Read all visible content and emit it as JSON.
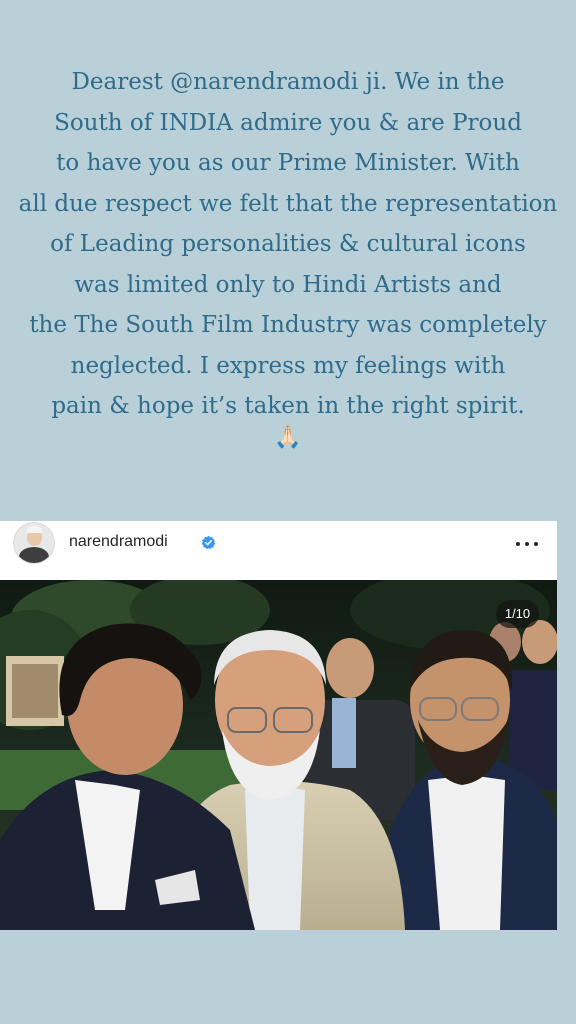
{
  "story": {
    "lines": [
      "Dearest @narendramodi ji. We in the",
      "South of INDIA admire you & are Proud",
      "to have you as our Prime Minister. With",
      "all due respect we felt that the representation",
      "of Leading personalities & cultural icons",
      "was limited only to Hindi Artists and",
      "the The South Film Industry was completely",
      "neglected. I express my feelings with",
      "pain & hope it’s taken in the right spirit."
    ],
    "emoji": "🙏🏻"
  },
  "post": {
    "username": "narendramodi",
    "verified_icon": "verified-badge-icon",
    "more_icon": "more-options-icon",
    "photo_counter": "1/10"
  },
  "colors": {
    "background": "#b9d0d8",
    "text": "#2f6b8a",
    "verified": "#3897f0"
  }
}
